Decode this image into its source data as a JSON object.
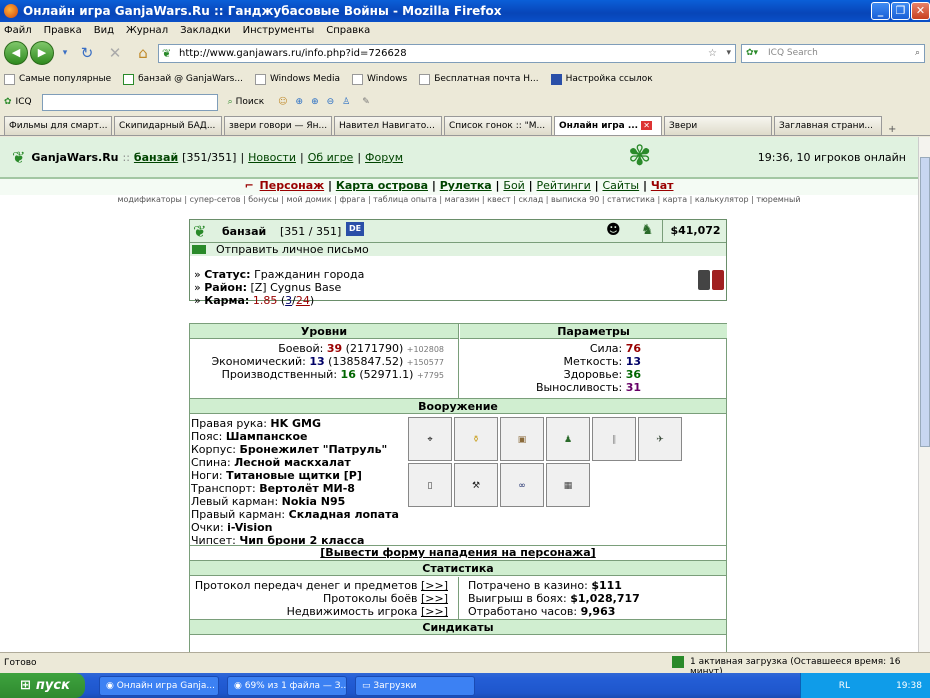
{
  "window": {
    "title": "Онлайн игра GanjaWars.Ru :: Ганджубасовые Войны - Mozilla Firefox"
  },
  "menu": [
    "Файл",
    "Правка",
    "Вид",
    "Журнал",
    "Закладки",
    "Инструменты",
    "Справка"
  ],
  "url": "http://www.ganjawars.ru/info.php?id=726628",
  "icq_search_placeholder": "ICQ Search",
  "bookmarks": [
    "Самые популярные",
    "банзай @ GanjaWars...",
    "Windows Media",
    "Windows",
    "Бесплатная почта Н...",
    "Настройка ссылок"
  ],
  "icqbar": {
    "icq": "ICQ",
    "search": "Поиск"
  },
  "tabs": [
    "Фильмы для смарт...",
    "Скипидарный БАД...",
    "звери говори — Ян...",
    "Навител Навигато...",
    "Список гонок :: \"М...",
    "Онлайн игра ...",
    "Звери",
    "Заглавная страни..."
  ],
  "game": {
    "site": "GanjaWars.Ru",
    "sep": "::",
    "user": "банзай",
    "hp": "[351/351]",
    "news": "Новости",
    "about": "Об игре",
    "forum": "Форум",
    "time_online": "19:36, 10 игроков онлайн",
    "nav": [
      "Персонаж",
      "Карта острова",
      "Рулетка",
      "Бой",
      "Рейтинги",
      "Сайты",
      "Чат"
    ],
    "subnav": "модификаторы | супер-сетов | бонусы | мой домик | фрага | таблица опыта | магазин | квест | склад | выписка 90 | статистика | карта | калькулятор | тюремный",
    "profile": {
      "name": "банзай",
      "hp": "[351 / 351]",
      "money": "$41,072",
      "send_msg": "Отправить личное письмо",
      "status_label": "Статус:",
      "status": "Гражданин города",
      "district_label": "Район:",
      "district": "[Z] Cygnus Base",
      "karma_label": "Карма:",
      "karma": "1.85",
      "karma_a": "3",
      "karma_b": "24"
    },
    "levels": {
      "header": "Уровни",
      "combat_label": "Боевой:",
      "combat": "39",
      "combat_exp": "(2171790)",
      "combat_add": "+102808",
      "econ_label": "Экономический:",
      "econ": "13",
      "econ_exp": "(1385847.52)",
      "econ_add": "+150577",
      "prod_label": "Производственный:",
      "prod": "16",
      "prod_exp": "(52971.1)",
      "prod_add": "+7795"
    },
    "params": {
      "header": "Параметры",
      "str_label": "Сила:",
      "str": "76",
      "acc_label": "Меткость:",
      "acc": "13",
      "hp_label": "Здоровье:",
      "hpv": "36",
      "end_label": "Выносливость:",
      "end": "31"
    },
    "weapons": {
      "header": "Вооружение",
      "items": [
        {
          "label": "Правая рука:",
          "value": "HK GMG"
        },
        {
          "label": "Пояс:",
          "value": "Шампанское"
        },
        {
          "label": "Корпус:",
          "value": "Бронежилет \"Патруль\""
        },
        {
          "label": "Спина:",
          "value": "Лесной маскхалат"
        },
        {
          "label": "Ноги:",
          "value": "Титановые щитки [P]"
        },
        {
          "label": "Транспорт:",
          "value": "Вертолёт МИ-8"
        },
        {
          "label": "Левый карман:",
          "value": "Nokia N95"
        },
        {
          "label": "Правый карман:",
          "value": "Складная лопата"
        },
        {
          "label": "Очки:",
          "value": "i-Vision"
        },
        {
          "label": "Чипсет:",
          "value": "Чип брони 2 класса"
        }
      ]
    },
    "attack": "[Вывести форму нападения на персонажа]",
    "stats": {
      "header": "Статистика",
      "proto1": "Протокол передач денег и предметов",
      "proto2": "Протоколы боёв",
      "proto3": "Недвижимость игрока",
      "more": "[>>]",
      "casino_label": "Потрачено в казино:",
      "casino": "$111",
      "win_label": "Выигрыш в боях:",
      "win": "$1,028,717",
      "hours_label": "Отработано часов:",
      "hours": "9,963"
    },
    "syndicates": "Синдикаты"
  },
  "status": {
    "left": "Готово",
    "right": "1 активная загрузка (Оставшееся время: 16 минут)"
  },
  "taskbar": {
    "start": "пуск",
    "tasks": [
      "Онлайн игра Ganja...",
      "69% из 1 файла — З...",
      "Загрузки"
    ],
    "lang": "RL",
    "clock": "19:38"
  }
}
